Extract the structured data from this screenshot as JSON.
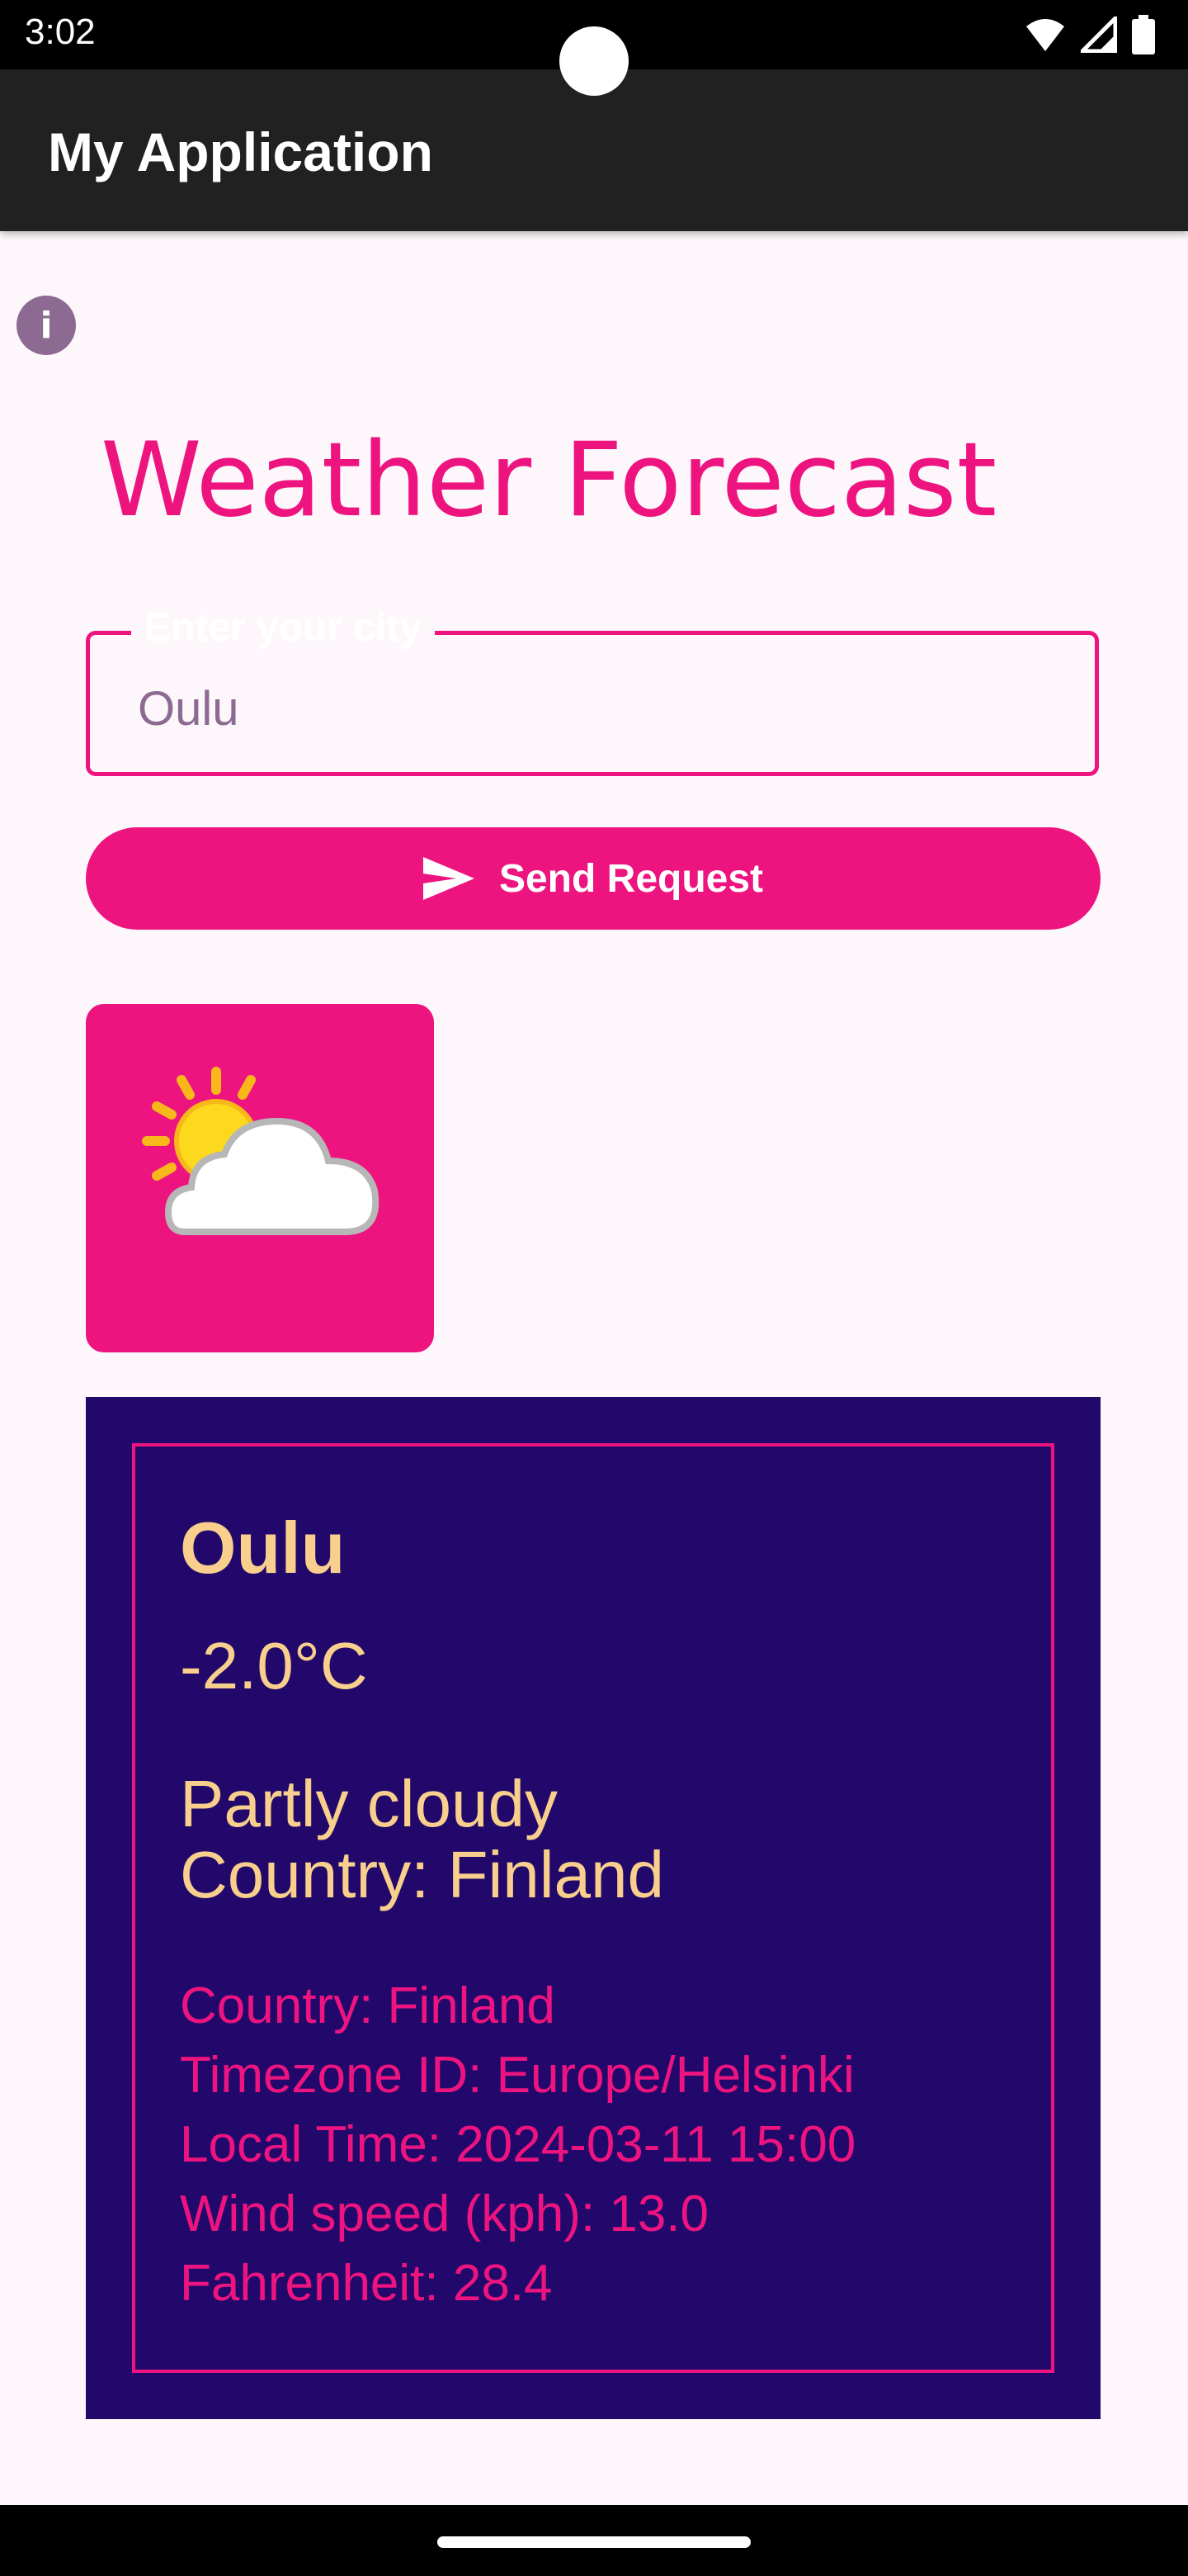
{
  "status_bar": {
    "time": "3:02",
    "icons": [
      "wifi-icon",
      "signal-icon",
      "battery-icon"
    ]
  },
  "app_bar": {
    "title": "My Application"
  },
  "info_button": {
    "icon": "info-icon"
  },
  "headline": "Weather Forecast",
  "city_field": {
    "label": "Enter your city",
    "value": "Oulu"
  },
  "send_button": {
    "icon": "send-icon",
    "label": "Send Request"
  },
  "weather_icon": "partly-cloudy-icon",
  "weather": {
    "city": "Oulu",
    "temperature": "-2.0°C",
    "condition": "Partly cloudy",
    "country_line": "Country: Finland",
    "details": [
      "Country: Finland",
      "Timezone ID: Europe/Helsinki",
      "Local Time: 2024-03-11 15:00",
      "Wind speed (kph): 13.0",
      "Fahrenheit: 28.4"
    ]
  },
  "colors": {
    "accent": "#ee1480",
    "card_background": "#22086b",
    "card_text": "#f8cf8c",
    "app_bar": "#212121",
    "page_background": "#fdf7fb"
  }
}
